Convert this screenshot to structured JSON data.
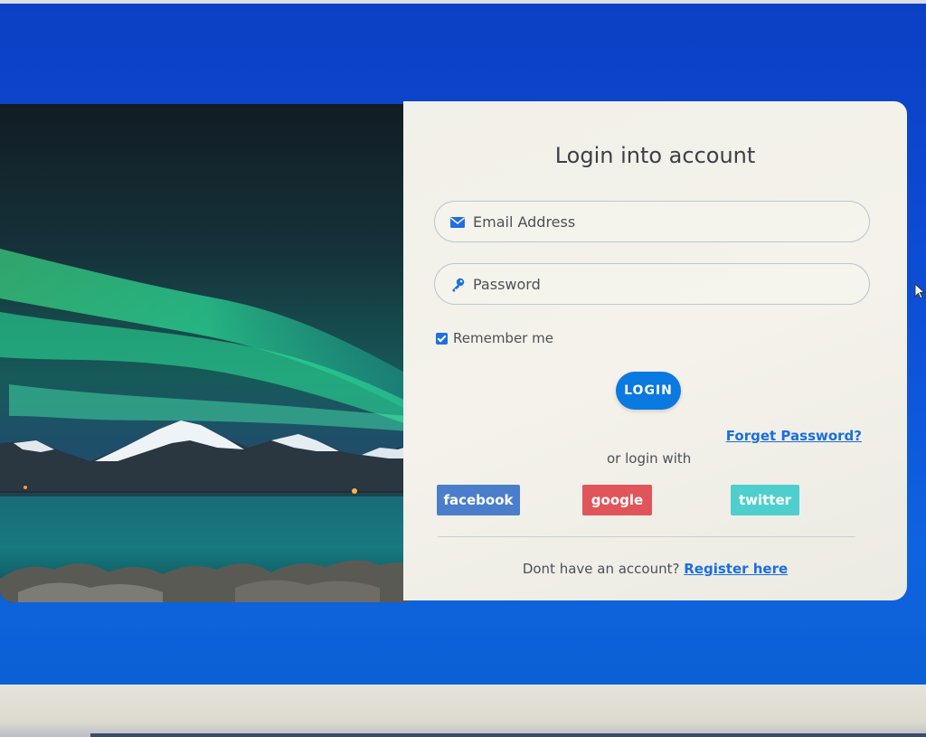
{
  "login": {
    "title": "Login into account",
    "email_placeholder": "Email Address",
    "password_placeholder": "Password",
    "remember_label": "Remember me",
    "remember_checked": true,
    "login_button": "LOGIN",
    "forgot_password": "Forget Password?",
    "or_login_with": "or login with",
    "social": {
      "facebook": "facebook",
      "google": "google",
      "twitter": "twitter"
    },
    "no_account_text": "Dont have an account?",
    "register_link": "Register here"
  },
  "icons": {
    "email": "envelope-icon",
    "password": "key-icon",
    "cursor": "mouse-pointer-icon"
  },
  "colors": {
    "background": "#0d4ed6",
    "panel": "#f1f0e9",
    "login_button": "#0a79e0",
    "facebook": "#4a7ecb",
    "google": "#e0555a",
    "twitter": "#4ecfce",
    "link": "#1a6ee0"
  }
}
